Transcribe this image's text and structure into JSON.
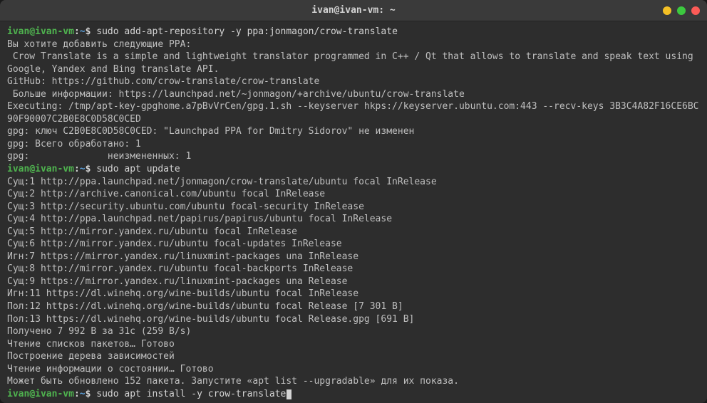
{
  "titlebar": {
    "title": "ivan@ivan-vm: ~"
  },
  "prompt": {
    "user": "ivan",
    "at": "@",
    "host": "ivan-vm",
    "colon": ":",
    "path": "~",
    "dollar": "$ "
  },
  "commands": {
    "cmd1": "sudo add-apt-repository -y ppa:jonmagon/crow-translate",
    "cmd2": "sudo apt update",
    "cmd3": "sudo apt install -y crow-translate"
  },
  "output": {
    "l1": "Вы хотите добавить следующие PPA:",
    "l2": " Crow Translate is a simple and lightweight translator programmed in C++ / Qt that allows to translate and speak text using Google, Yandex and Bing translate API.",
    "l3": "GitHub: https://github.com/crow-translate/crow-translate",
    "l4": " Больше информации: https://launchpad.net/~jonmagon/+archive/ubuntu/crow-translate",
    "l5": "Executing: /tmp/apt-key-gpghome.a7pBvVrCen/gpg.1.sh --keyserver hkps://keyserver.ubuntu.com:443 --recv-keys 3B3C4A82F16CE6BC90F90007C2B0E8C0D58C0CED",
    "l6": "gpg: ключ C2B0E8C0D58C0CED: \"Launchpad PPA for Dmitry Sidorov\" не изменен",
    "l7": "gpg: Всего обработано: 1",
    "l8": "gpg:              неизмененных: 1",
    "u1": "Сущ:1 http://ppa.launchpad.net/jonmagon/crow-translate/ubuntu focal InRelease",
    "u2": "Сущ:2 http://archive.canonical.com/ubuntu focal InRelease",
    "u3": "Сущ:3 http://security.ubuntu.com/ubuntu focal-security InRelease",
    "u4": "Сущ:4 http://ppa.launchpad.net/papirus/papirus/ubuntu focal InRelease",
    "u5": "Сущ:5 http://mirror.yandex.ru/ubuntu focal InRelease",
    "u6": "Сущ:6 http://mirror.yandex.ru/ubuntu focal-updates InRelease",
    "u7": "Игн:7 https://mirror.yandex.ru/linuxmint-packages una InRelease",
    "u8": "Сущ:8 http://mirror.yandex.ru/ubuntu focal-backports InRelease",
    "u9": "Сущ:9 https://mirror.yandex.ru/linuxmint-packages una Release",
    "u10": "Игн:11 https://dl.winehq.org/wine-builds/ubuntu focal InRelease",
    "u11": "Пол:12 https://dl.winehq.org/wine-builds/ubuntu focal Release [7 301 B]",
    "u12": "Пол:13 https://dl.winehq.org/wine-builds/ubuntu focal Release.gpg [691 B]",
    "u13": "Получено 7 992 B за 31с (259 B/s)",
    "u14": "Чтение списков пакетов… Готово",
    "u15": "Построение дерева зависимостей",
    "u16": "Чтение информации о состоянии… Готово",
    "u17": "Может быть обновлено 152 пакета. Запустите «apt list --upgradable» для их показа."
  }
}
